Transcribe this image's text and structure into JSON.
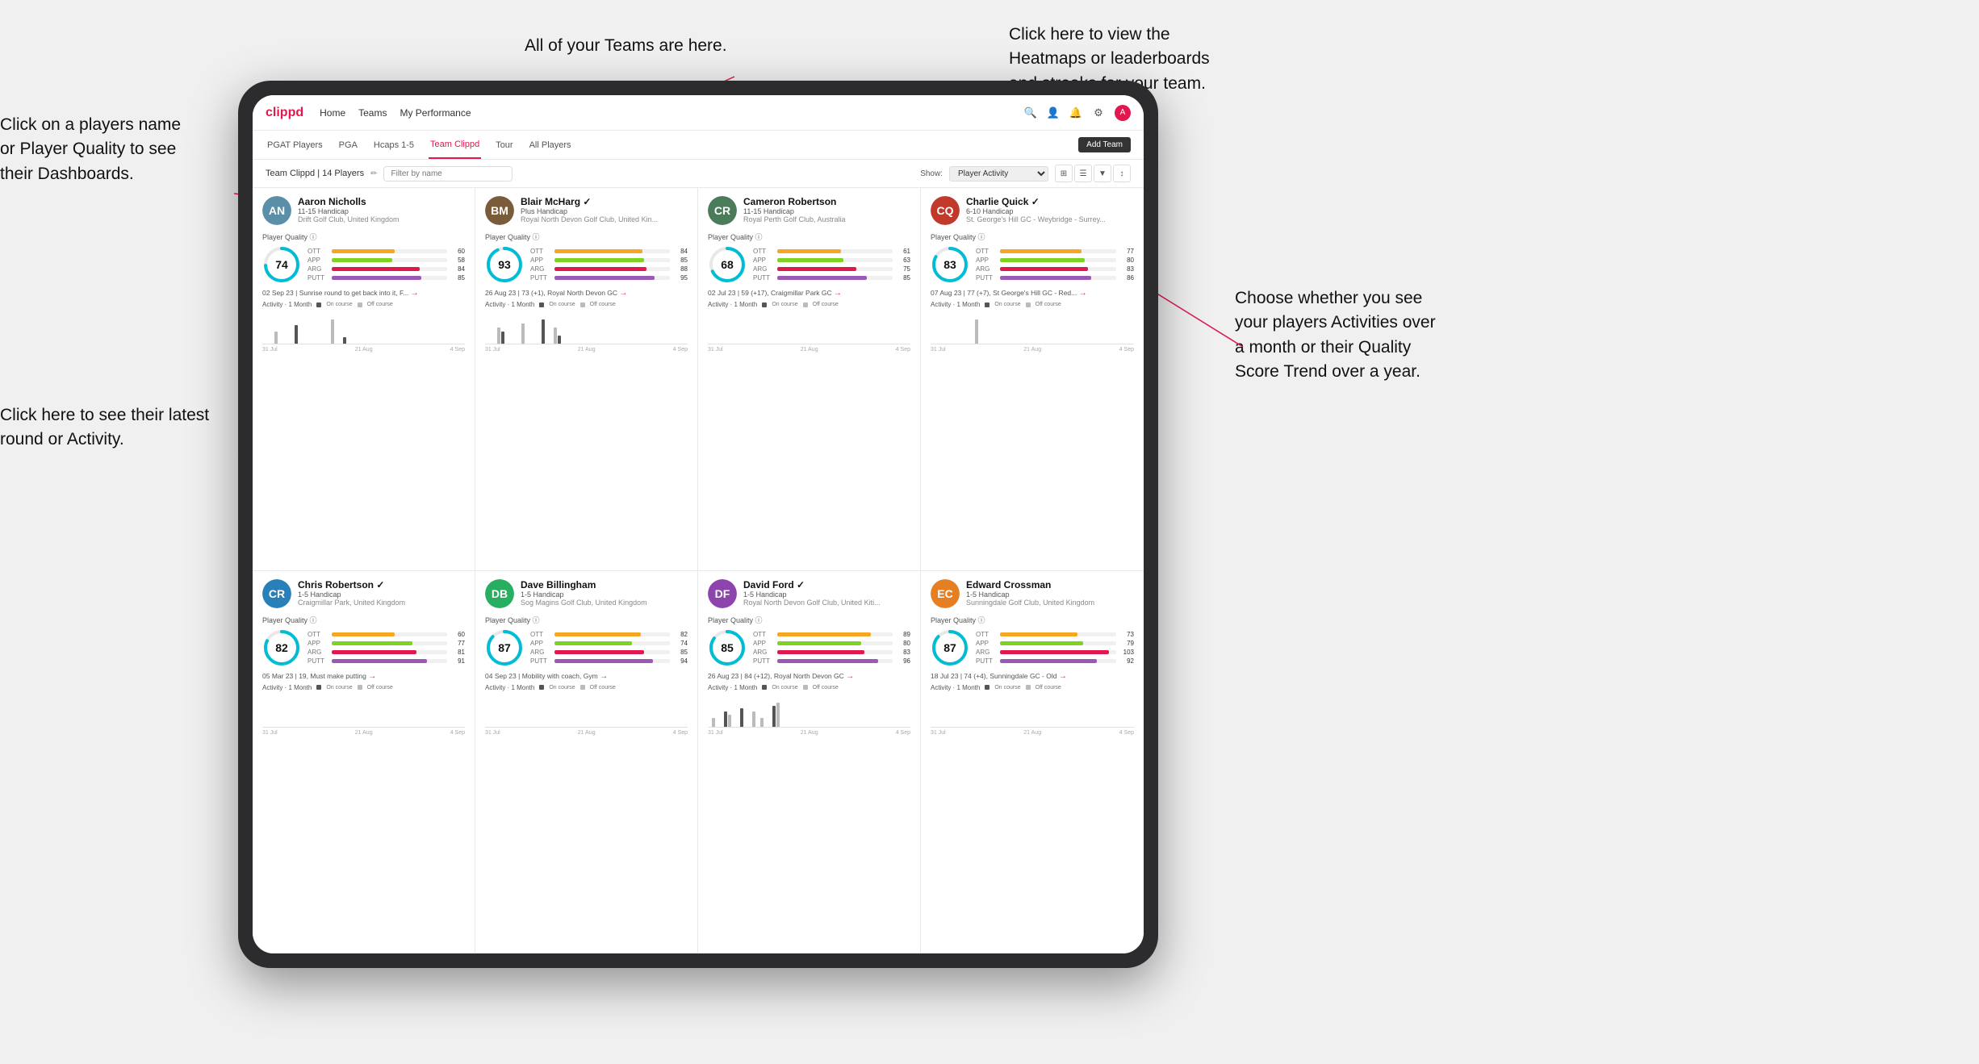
{
  "annotations": {
    "teams_note": "All of your Teams are here.",
    "heatmaps_note": "Click here to view the\nHeatmaps or leaderboards\nand streaks for your team.",
    "players_name_note": "Click on a players name\nor Player Quality to see\ntheir Dashboards.",
    "latest_round_note": "Click here to see their latest\nround or Activity.",
    "activities_note": "Choose whether you see\nyour players Activities over\na month or their Quality\nScore Trend over a year."
  },
  "navbar": {
    "logo": "clippd",
    "links": [
      "Home",
      "Teams",
      "My Performance"
    ],
    "icons": [
      "search",
      "person",
      "bell",
      "settings",
      "avatar"
    ]
  },
  "subnav": {
    "links": [
      "PGAT Players",
      "PGA",
      "Hcaps 1-5",
      "Team Clippd",
      "Tour",
      "All Players"
    ],
    "active": "Team Clippd",
    "add_team": "Add Team"
  },
  "team_header": {
    "title": "Team Clippd | 14 Players",
    "filter_placeholder": "Filter by name",
    "show_label": "Show:",
    "show_select": "Player Activity"
  },
  "colors": {
    "ott": "#f5a623",
    "app": "#7ed321",
    "arg": "#e0184e",
    "putt": "#9b59b6",
    "oncourse": "#333",
    "offcourse": "#aaa",
    "accent": "#e0184e"
  },
  "players": [
    {
      "name": "Aaron Nicholls",
      "handicap": "11-15 Handicap",
      "club": "Drift Golf Club, United Kingdom",
      "quality": 74,
      "ott": 60,
      "app": 58,
      "arg": 84,
      "putt": 85,
      "latest": "02 Sep 23 | Sunrise round to get back into it, F...",
      "avatar_color": "#5b8fa8",
      "avatar_initials": "AN",
      "chart": [
        0,
        0,
        0,
        2,
        0,
        0,
        0,
        0,
        3,
        0,
        0,
        0,
        0,
        0,
        0,
        0,
        0,
        4,
        0,
        0,
        1,
        0
      ]
    },
    {
      "name": "Blair McHarg",
      "handicap": "Plus Handicap",
      "club": "Royal North Devon Golf Club, United Kin...",
      "quality": 93,
      "ott": 84,
      "app": 85,
      "arg": 88,
      "putt": 95,
      "latest": "26 Aug 23 | 73 (+1), Royal North Devon GC",
      "avatar_color": "#7a5c3a",
      "avatar_initials": "BM",
      "chart": [
        0,
        0,
        0,
        4,
        3,
        0,
        0,
        0,
        0,
        5,
        0,
        0,
        0,
        0,
        6,
        0,
        0,
        4,
        2,
        0,
        0,
        0
      ]
    },
    {
      "name": "Cameron Robertson",
      "handicap": "11-15 Handicap",
      "club": "Royal Perth Golf Club, Australia",
      "quality": 68,
      "ott": 61,
      "app": 63,
      "arg": 75,
      "putt": 85,
      "latest": "02 Jul 23 | 59 (+17), Craigmillar Park GC",
      "avatar_color": "#4a7c59",
      "avatar_initials": "CR",
      "chart": [
        0,
        0,
        0,
        0,
        0,
        0,
        0,
        0,
        0,
        0,
        0,
        0,
        0,
        0,
        0,
        0,
        0,
        0,
        0,
        0,
        0,
        0
      ]
    },
    {
      "name": "Charlie Quick",
      "handicap": "6-10 Handicap",
      "club": "St. George's Hill GC - Weybridge - Surrey...",
      "quality": 83,
      "ott": 77,
      "app": 80,
      "arg": 83,
      "putt": 86,
      "latest": "07 Aug 23 | 77 (+7), St George's Hill GC - Red...",
      "avatar_color": "#c0392b",
      "avatar_initials": "CQ",
      "chart": [
        0,
        0,
        0,
        0,
        0,
        0,
        0,
        0,
        0,
        0,
        0,
        3,
        0,
        0,
        0,
        0,
        0,
        0,
        0,
        0,
        0,
        0
      ]
    },
    {
      "name": "Chris Robertson",
      "handicap": "1-5 Handicap",
      "club": "Craigmillar Park, United Kingdom",
      "quality": 82,
      "ott": 60,
      "app": 77,
      "arg": 81,
      "putt": 91,
      "latest": "05 Mar 23 | 19, Must make putting",
      "avatar_color": "#2980b9",
      "avatar_initials": "CR",
      "chart": [
        0,
        0,
        0,
        0,
        0,
        0,
        0,
        0,
        0,
        0,
        0,
        0,
        0,
        0,
        0,
        0,
        0,
        0,
        0,
        0,
        0,
        0
      ]
    },
    {
      "name": "Dave Billingham",
      "handicap": "1-5 Handicap",
      "club": "Sog Magins Golf Club, United Kingdom",
      "quality": 87,
      "ott": 82,
      "app": 74,
      "arg": 85,
      "putt": 94,
      "latest": "04 Sep 23 | Mobility with coach, Gym",
      "avatar_color": "#27ae60",
      "avatar_initials": "DB",
      "chart": [
        0,
        0,
        0,
        0,
        0,
        0,
        0,
        0,
        0,
        0,
        0,
        0,
        0,
        0,
        0,
        0,
        0,
        0,
        0,
        0,
        0,
        0
      ]
    },
    {
      "name": "David Ford",
      "handicap": "1-5 Handicap",
      "club": "Royal North Devon Golf Club, United Kiti...",
      "quality": 85,
      "ott": 89,
      "app": 80,
      "arg": 83,
      "putt": 96,
      "latest": "26 Aug 23 | 84 (+12), Royal North Devon GC",
      "avatar_color": "#8e44ad",
      "avatar_initials": "DF",
      "chart": [
        0,
        3,
        0,
        0,
        5,
        4,
        0,
        0,
        6,
        0,
        0,
        5,
        0,
        3,
        0,
        0,
        7,
        8,
        0,
        0,
        0,
        0
      ]
    },
    {
      "name": "Edward Crossman",
      "handicap": "1-5 Handicap",
      "club": "Sunningdale Golf Club, United Kingdom",
      "quality": 87,
      "ott": 73,
      "app": 79,
      "arg": 103,
      "putt": 92,
      "latest": "18 Jul 23 | 74 (+4), Sunningdale GC - Old",
      "avatar_color": "#e67e22",
      "avatar_initials": "EC",
      "chart": [
        0,
        0,
        0,
        0,
        0,
        0,
        0,
        0,
        0,
        0,
        0,
        0,
        0,
        0,
        0,
        0,
        0,
        0,
        0,
        0,
        0,
        0
      ]
    }
  ]
}
